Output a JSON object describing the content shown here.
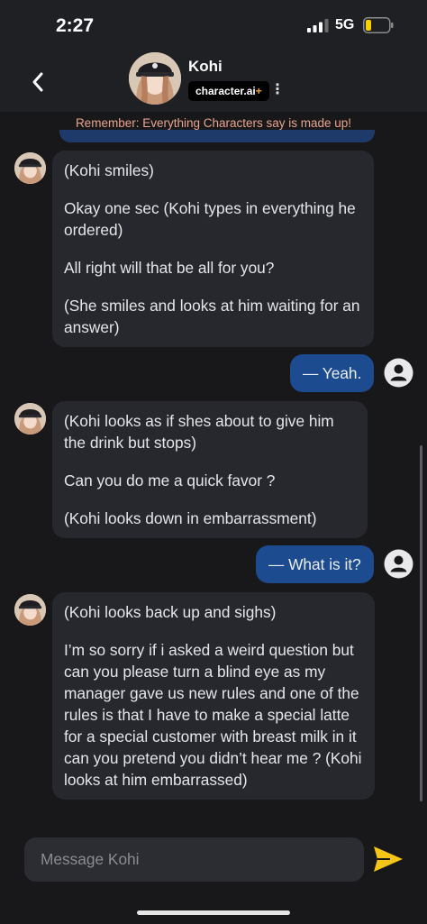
{
  "status_bar": {
    "time": "2:27",
    "network": "5G"
  },
  "header": {
    "character_name": "Kohi",
    "brand": "character.ai",
    "brand_plus": "+"
  },
  "chat": {
    "disclaimer": "Remember: Everything Characters say is made up!",
    "messages": [
      {
        "role": "character",
        "paragraphs": [
          "(Kohi smiles)",
          "Okay one sec (Kohi types in everything he ordered)",
          "All right will that be all for you?",
          "(She smiles and looks at him waiting for an answer)"
        ]
      },
      {
        "role": "user",
        "text": "— Yeah."
      },
      {
        "role": "character",
        "paragraphs": [
          "(Kohi looks as if shes about to give him the drink but stops)",
          "Can you do me a quick favor ?",
          "(Kohi looks down in embarrassment)"
        ]
      },
      {
        "role": "user",
        "text": "— What is it?"
      },
      {
        "role": "character",
        "paragraphs": [
          "(Kohi looks back up and sighs)",
          "I’m so sorry if i asked a weird question but can you please turn a blind eye as my manager gave us new rules and one of the rules is that I have to make a special latte for a special customer with breast milk in it can you pretend you didn’t hear me ? (Kohi looks at him embarrassed)"
        ]
      }
    ]
  },
  "composer": {
    "placeholder": "Message Kohi"
  },
  "colors": {
    "user_bubble": "#1c4b8f",
    "character_bubble": "#27282e",
    "send_icon": "#f5c518",
    "disclaimer": "#e8a48e"
  },
  "icons": [
    "back-chevron-icon",
    "kebab-menu-icon",
    "user-avatar-icon",
    "send-icon",
    "signal-icon",
    "battery-icon"
  ]
}
